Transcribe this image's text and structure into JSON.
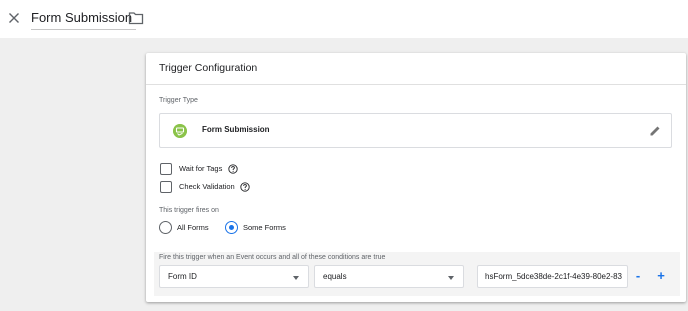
{
  "header": {
    "title": "Form Submission",
    "close_icon": "close-icon",
    "folder_icon": "folder-icon"
  },
  "card": {
    "title": "Trigger Configuration",
    "trigger_type_label": "Trigger Type",
    "trigger_type": {
      "name": "Form Submission",
      "icon": "form-submission-icon",
      "icon_color": "#8bc34a",
      "edit_icon": "pencil-icon"
    },
    "options": {
      "wait_for_tags": {
        "label": "Wait for Tags",
        "checked": false
      },
      "check_validation": {
        "label": "Check Validation",
        "checked": false
      }
    },
    "fires_on_label": "This trigger fires on",
    "fires_on": {
      "all_forms": {
        "label": "All Forms",
        "selected": false
      },
      "some_forms": {
        "label": "Some Forms",
        "selected": true
      }
    },
    "condition_label": "Fire this trigger when an Event occurs and all of these conditions are true",
    "condition": {
      "variable": "Form ID",
      "operator": "equals",
      "value": "hsForm_5dce38de-2c1f-4e39-80e2-83",
      "remove_label": "-",
      "add_label": "+"
    }
  },
  "colors": {
    "accent": "#1a73e8",
    "workspace_bg": "#efefef"
  }
}
